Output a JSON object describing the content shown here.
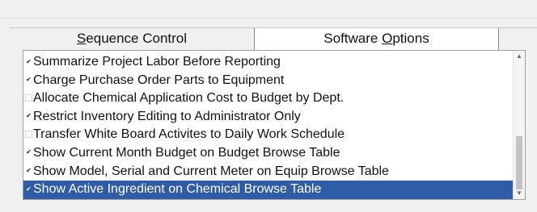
{
  "tabs": {
    "sequence_control": {
      "pre": "",
      "mnemonic": "S",
      "post": "equence Control"
    },
    "software_options": {
      "pre": "Software ",
      "mnemonic": "O",
      "post": "ptions"
    }
  },
  "options": [
    {
      "label": "Summarize Project Labor Before Reporting",
      "checked": true
    },
    {
      "label": "Charge Purchase Order Parts to Equipment",
      "checked": true
    },
    {
      "label": "Allocate Chemical Application Cost to Budget by Dept.",
      "checked": false
    },
    {
      "label": "Restrict Inventory Editing to Administrator Only",
      "checked": true
    },
    {
      "label": "Transfer White Board Activites to Daily Work Schedule",
      "checked": false
    },
    {
      "label": "Show Current Month Budget on Budget Browse Table",
      "checked": true
    },
    {
      "label": "Show Model, Serial and Current Meter on Equip Browse Table",
      "checked": true
    },
    {
      "label": "Show Active Ingredient on Chemical Browse Table",
      "checked": true,
      "selected": true
    }
  ],
  "scrollbar": {
    "up_icon": "chevron-up-icon",
    "down_icon": "chevron-down-icon"
  },
  "colors": {
    "selection": "#2f5ba7",
    "active_tab": "#ffffff"
  }
}
